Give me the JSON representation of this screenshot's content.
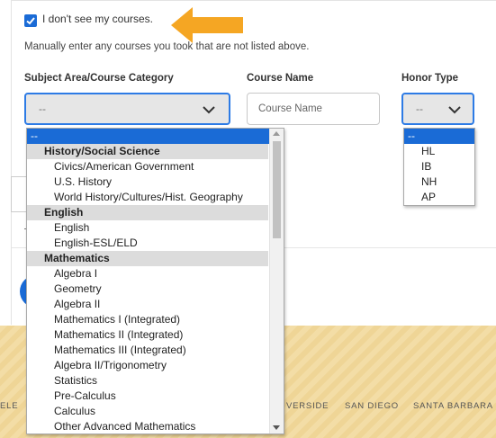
{
  "form": {
    "checkbox_label": "I don't see my courses.",
    "checkbox_checked": true,
    "hint": "Manually enter any courses you took that are not listed above.",
    "columns": {
      "subject": "Subject Area/Course Category",
      "course": "Course Name",
      "honor": "Honor Type"
    },
    "subject_value": "--",
    "course_placeholder": "Course Name",
    "honor_value": "--"
  },
  "subject_dropdown": {
    "options": [
      {
        "kind": "option",
        "label": "--",
        "selected": true
      },
      {
        "kind": "group",
        "label": "History/Social Science"
      },
      {
        "kind": "option",
        "label": "Civics/American Government"
      },
      {
        "kind": "option",
        "label": "U.S. History"
      },
      {
        "kind": "option",
        "label": "World History/Cultures/Hist. Geography"
      },
      {
        "kind": "group",
        "label": "English"
      },
      {
        "kind": "option",
        "label": "English"
      },
      {
        "kind": "option",
        "label": "English-ESL/ELD"
      },
      {
        "kind": "group",
        "label": "Mathematics"
      },
      {
        "kind": "option",
        "label": "Algebra I"
      },
      {
        "kind": "option",
        "label": "Geometry"
      },
      {
        "kind": "option",
        "label": "Algebra II"
      },
      {
        "kind": "option",
        "label": "Mathematics I (Integrated)"
      },
      {
        "kind": "option",
        "label": "Mathematics II (Integrated)"
      },
      {
        "kind": "option",
        "label": "Mathematics III (Integrated)"
      },
      {
        "kind": "option",
        "label": "Algebra II/Trigonometry"
      },
      {
        "kind": "option",
        "label": "Statistics"
      },
      {
        "kind": "option",
        "label": "Pre-Calculus"
      },
      {
        "kind": "option",
        "label": "Calculus"
      },
      {
        "kind": "option",
        "label": "Other Advanced Mathematics"
      }
    ]
  },
  "honor_dropdown": {
    "options": [
      {
        "label": "--",
        "selected": true
      },
      {
        "label": "HL"
      },
      {
        "label": "IB"
      },
      {
        "label": "NH"
      },
      {
        "label": "AP"
      }
    ]
  },
  "footer": {
    "campus_links": [
      "ELE",
      "VERSIDE",
      "SAN DIEGO",
      "SANTA BARBARA"
    ]
  },
  "colors": {
    "accent": "#1a6bd6",
    "arrow": "#f5a623",
    "band": "#f3dda6"
  },
  "icons": {
    "checkbox": "check-icon",
    "select_arrow": "chevron-down-icon",
    "annotation": "arrow-left-icon"
  }
}
